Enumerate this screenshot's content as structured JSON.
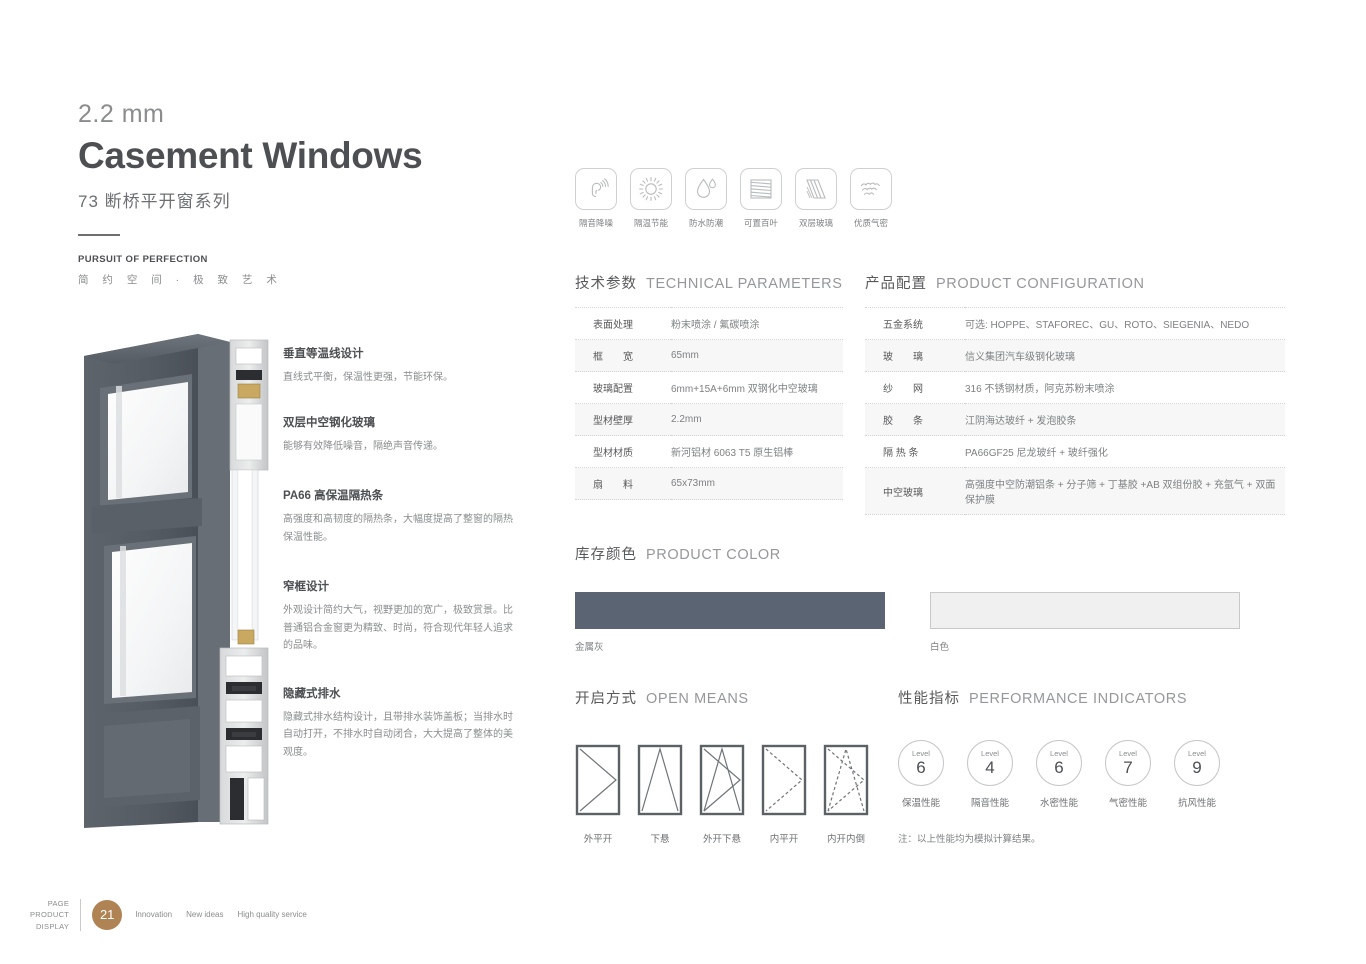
{
  "header": {
    "thickness": "2.2 mm",
    "title": "Casement Windows",
    "series": "73 断桥平开窗系列",
    "pursuit": "PURSUIT OF PERFECTION",
    "slogan": "简 约 空 间 · 极 致 艺 术"
  },
  "feature_icons": [
    {
      "icon": "ear-soundwave-icon",
      "label": "隔音降噪"
    },
    {
      "icon": "sun-icon",
      "label": "隔温节能"
    },
    {
      "icon": "water-drop-icon",
      "label": "防水防潮"
    },
    {
      "icon": "louver-blinds-icon",
      "label": "可置百叶"
    },
    {
      "icon": "double-glass-icon",
      "label": "双层玻璃"
    },
    {
      "icon": "airtight-cloud-icon",
      "label": "优质气密"
    }
  ],
  "features": [
    {
      "title": "垂直等温线设计",
      "desc": "直线式平衡，保温性更强，节能环保。"
    },
    {
      "title": "双层中空钢化玻璃",
      "desc": "能够有效降低噪音，隔绝声音传递。"
    },
    {
      "title": "PA66 高保温隔热条",
      "desc": "高强度和高韧度的隔热条，大幅度提高了整窗的隔热保温性能。"
    },
    {
      "title": "窄框设计",
      "desc": "外观设计简约大气，视野更加的宽广，极致赏景。比普通铝合金窗更为精致、时尚，符合现代年轻人追求的品味。"
    },
    {
      "title": "隐藏式排水",
      "desc": "隐藏式排水结构设计，且带排水装饰盖板；当排水时自动打开，不排水时自动闭合，大大提高了整体的美观度。"
    }
  ],
  "technical": {
    "heading_cn": "技术参数",
    "heading_en": "TECHNICAL PARAMETERS",
    "rows": [
      {
        "key": "表面处理",
        "value": "粉末喷涂 / 氟碳喷涂"
      },
      {
        "key": "框　　宽",
        "value": "65mm"
      },
      {
        "key": "玻璃配置",
        "value": "6mm+15A+6mm 双钢化中空玻璃"
      },
      {
        "key": "型材壁厚",
        "value": "2.2mm"
      },
      {
        "key": "型材材质",
        "value": "新河铝材  6063 T5 原生铝棒"
      },
      {
        "key": "扇　　料",
        "value": "65x73mm"
      }
    ]
  },
  "configuration": {
    "heading_cn": "产品配置",
    "heading_en": "PRODUCT CONFIGURATION",
    "rows": [
      {
        "key": "五金系统",
        "value": "可选: HOPPE、STAFOREC、GU、ROTO、SIEGENIA、NEDO"
      },
      {
        "key": "玻　　璃",
        "value": "信义集团汽车级钢化玻璃"
      },
      {
        "key": "纱　　网",
        "value": "316 不锈钢材质，阿克苏粉末喷涂"
      },
      {
        "key": "胶　　条",
        "value": "江阴海达玻纤 + 发泡胶条"
      },
      {
        "key": "隔 热 条",
        "value": "PA66GF25 尼龙玻纤 + 玻纤强化"
      },
      {
        "key": "中空玻璃",
        "value": "高强度中空防潮铝条 + 分子筛 + 丁基胶 +AB 双组份胶 + 充氩气 + 双面保护膜"
      }
    ]
  },
  "color": {
    "heading_cn": "库存颜色",
    "heading_en": "PRODUCT COLOR",
    "swatches": [
      {
        "name": "金属灰",
        "hex": "#5a6472"
      },
      {
        "name": "白色",
        "hex": "#f0f0f0"
      }
    ]
  },
  "open_means": {
    "heading_cn": "开启方式",
    "heading_en": "OPEN MEANS",
    "items": [
      {
        "name": "外平开",
        "type": "outward-casement"
      },
      {
        "name": "下悬",
        "type": "bottom-hung"
      },
      {
        "name": "外开下悬",
        "type": "outward-bottom-hung"
      },
      {
        "name": "内平开",
        "type": "inward-casement"
      },
      {
        "name": "内开内倒",
        "type": "tilt-turn"
      }
    ]
  },
  "performance": {
    "heading_cn": "性能指标",
    "heading_en": "PERFORMANCE INDICATORS",
    "level_label": "Level",
    "items": [
      {
        "level": "6",
        "name": "保温性能"
      },
      {
        "level": "4",
        "name": "隔音性能"
      },
      {
        "level": "6",
        "name": "水密性能"
      },
      {
        "level": "7",
        "name": "气密性能"
      },
      {
        "level": "9",
        "name": "抗风性能"
      }
    ],
    "note": "注：以上性能均为模拟计算结果。"
  },
  "footer": {
    "left_line1": "PAGE",
    "left_line2": "PRODUCT",
    "left_line3": "DISPLAY",
    "page_number": "21",
    "words": [
      "Innovation",
      "New ideas",
      "High quality service"
    ],
    "badge_color": "#b08354"
  }
}
